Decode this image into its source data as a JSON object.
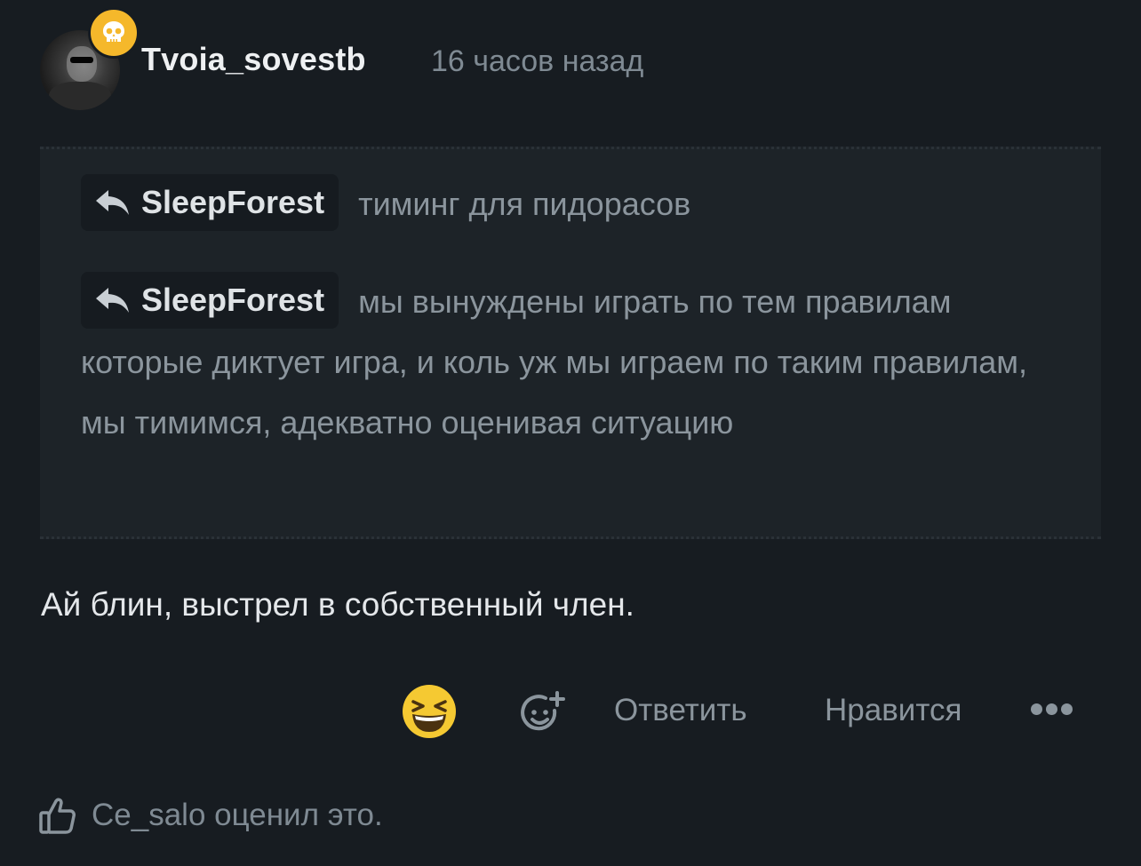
{
  "post": {
    "username": "Tvoia_sovestb",
    "timestamp": "16 часов назад",
    "badge_icon": "skull-icon",
    "badge_color": "#f5b82b"
  },
  "quote": {
    "replies": [
      {
        "mention": "SleepForest",
        "text": "тиминг для пидорасов"
      },
      {
        "mention": "SleepForest",
        "text": "мы вынуждены играть по тем правилам которые диктует игра, и коль уж мы играем по таким правилам, мы тимимся, адекватно оценивая ситуацию"
      }
    ]
  },
  "comment": {
    "text": "Ай блин, выстрел в собственный член."
  },
  "actions": {
    "reaction_icon": "grinning-squinting-face-icon",
    "add_reaction_icon": "add-reaction-icon",
    "reply_label": "Ответить",
    "like_label": "Нравится",
    "more_icon": "more-dots-icon"
  },
  "likes": {
    "text": "Ce_salo оценил это."
  },
  "colors": {
    "background": "#171c21",
    "quote_background": "#1d2328",
    "muted_text": "#8b959d",
    "emoji_yellow": "#f5c932"
  }
}
